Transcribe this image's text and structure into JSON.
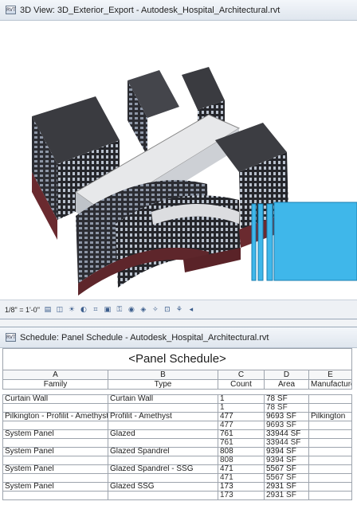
{
  "view3d": {
    "title": "3D View: 3D_Exterior_Export - Autodesk_Hospital_Architectural.rvt",
    "title_icon": "revit-view-icon",
    "scale": "1/8\" = 1'-0\"",
    "toolbar_icons": [
      "detail-level-icon",
      "visual-style-icon",
      "sun-path-icon",
      "shadows-icon",
      "crop-view-icon",
      "show-crop-icon",
      "unlock-3d-icon",
      "temporary-hide-icon",
      "reveal-hidden-icon",
      "analytical-model-icon",
      "highlight-icon",
      "render-icon",
      "scroll-left-icon"
    ],
    "colors": {
      "wall": "#2f2f33",
      "brick": "#6a2a2f",
      "roof": "#e8e8ea",
      "glass": "#3fb7ea"
    }
  },
  "schedule": {
    "title": "Schedule: Panel Schedule - Autodesk_Hospital_Architectural.rvt",
    "title_icon": "revit-schedule-icon",
    "heading": "<Panel Schedule>",
    "column_letters": [
      "A",
      "B",
      "C",
      "D",
      "E"
    ],
    "column_headers": [
      "Family",
      "Type",
      "Count",
      "Area",
      "Manufacturer"
    ],
    "rows": [
      {
        "kind": "gap"
      },
      {
        "kind": "data",
        "cells": [
          "Curtain Wall",
          "Curtain Wall",
          "1",
          "78 SF",
          ""
        ]
      },
      {
        "kind": "subtotal",
        "cells": [
          "",
          "",
          "1",
          "78 SF",
          ""
        ]
      },
      {
        "kind": "data",
        "cells": [
          "Pilkington - Profilit - Amethyst",
          "Profilit - Amethyst",
          "477",
          "9693 SF",
          "Pilkington"
        ]
      },
      {
        "kind": "subtotal",
        "cells": [
          "",
          "",
          "477",
          "9693 SF",
          ""
        ]
      },
      {
        "kind": "data",
        "cells": [
          "System Panel",
          "Glazed",
          "761",
          "33944 SF",
          ""
        ]
      },
      {
        "kind": "subtotal",
        "cells": [
          "",
          "",
          "761",
          "33944 SF",
          ""
        ]
      },
      {
        "kind": "data",
        "cells": [
          "System Panel",
          "Glazed Spandrel",
          "808",
          "9394 SF",
          ""
        ]
      },
      {
        "kind": "subtotal",
        "cells": [
          "",
          "",
          "808",
          "9394 SF",
          ""
        ]
      },
      {
        "kind": "data",
        "cells": [
          "System Panel",
          "Glazed Spandrel - SSG",
          "471",
          "5567 SF",
          ""
        ]
      },
      {
        "kind": "subtotal",
        "cells": [
          "",
          "",
          "471",
          "5567 SF",
          ""
        ]
      },
      {
        "kind": "data",
        "cells": [
          "System Panel",
          "Glazed SSG",
          "173",
          "2931 SF",
          ""
        ]
      },
      {
        "kind": "subtotal",
        "cells": [
          "",
          "",
          "173",
          "2931 SF",
          ""
        ]
      }
    ]
  }
}
